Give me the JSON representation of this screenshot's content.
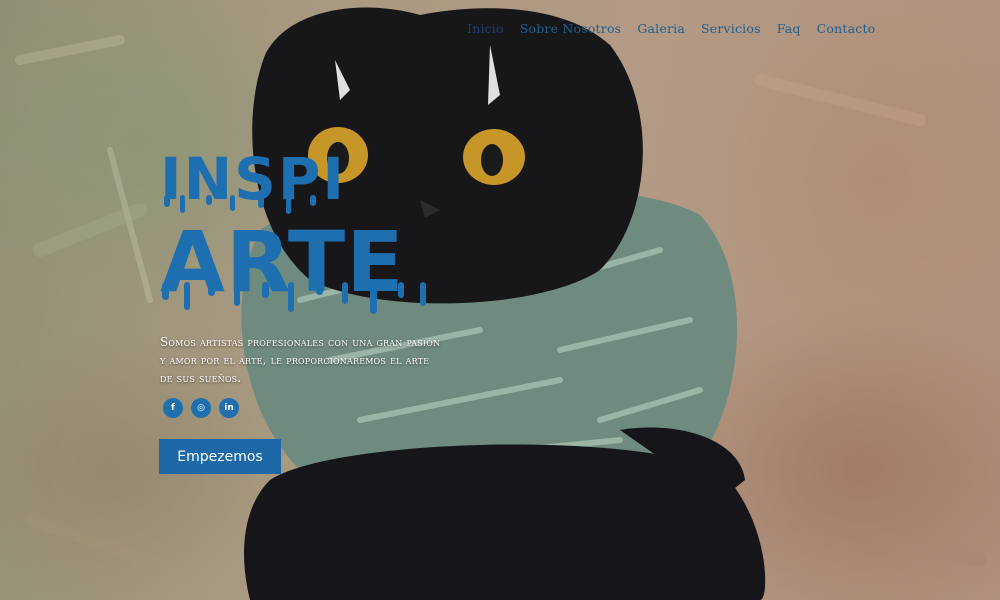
{
  "nav": {
    "items": [
      {
        "label": "Inicio",
        "active": true
      },
      {
        "label": "Sobre Nosotros",
        "active": false
      },
      {
        "label": "Galeria",
        "active": false
      },
      {
        "label": "Servicios",
        "active": false
      },
      {
        "label": "Faq",
        "active": false
      },
      {
        "label": "Contacto",
        "active": false
      }
    ]
  },
  "hero": {
    "title_line1": "INSPI",
    "title_line2": "ARTE",
    "description": "Somos artistas profesionales con una gran pasión y amor por el arte, le proporcionaremos el arte de sus sueños.",
    "cta_label": "Empezemos"
  },
  "social": [
    {
      "icon": "facebook-icon",
      "glyph": "f"
    },
    {
      "icon": "instagram-icon",
      "glyph": "◎"
    },
    {
      "icon": "linkedin-icon",
      "glyph": "in"
    }
  ],
  "colors": {
    "accent": "#1e6fb0",
    "button": "#1d69a8",
    "nav_text": "#1f5e8e"
  }
}
